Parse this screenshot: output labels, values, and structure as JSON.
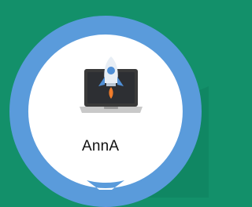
{
  "app": {
    "label": "AnnA",
    "icon": "rocket-laptop-icon"
  },
  "colors": {
    "background": "#13906a",
    "ring": "#5a9bdb",
    "card": "#ffffff",
    "laptop_body": "#3a3a3a",
    "laptop_base": "#c9c9c9",
    "rocket_body": "#e8eef5",
    "rocket_window": "#4f8fd6",
    "flame": "#f07c2b"
  }
}
